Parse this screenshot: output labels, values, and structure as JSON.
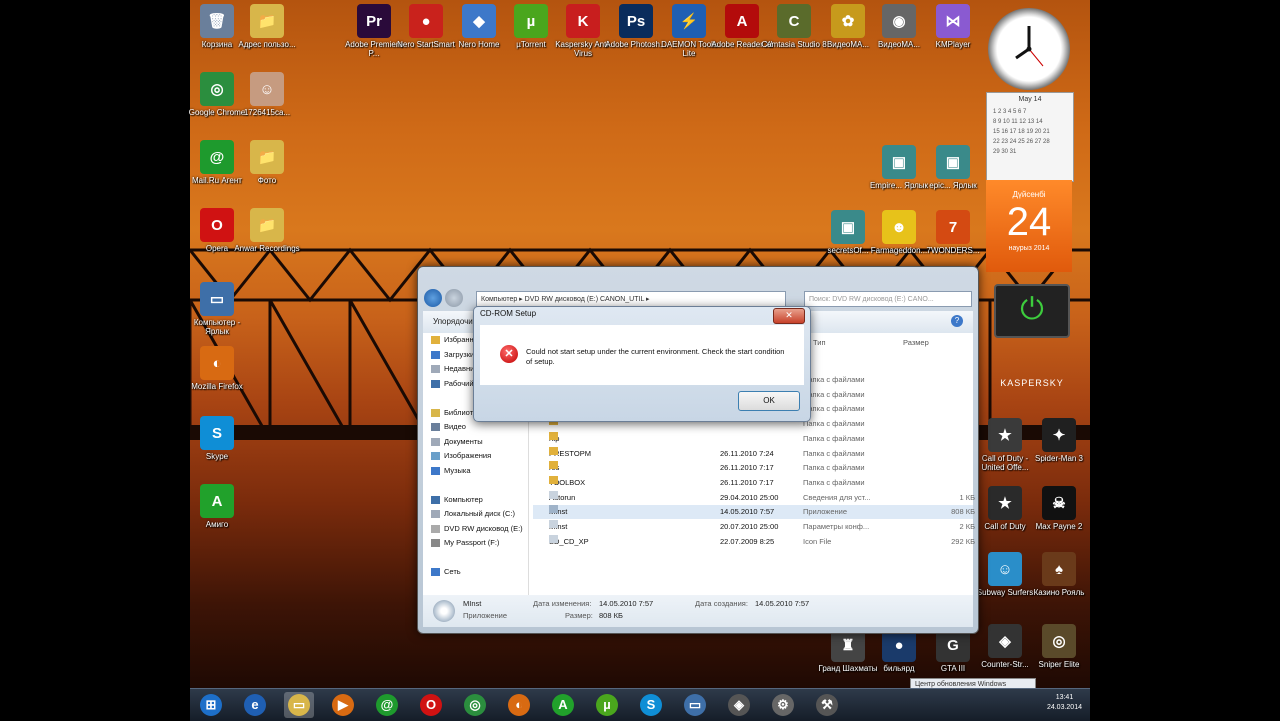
{
  "desktop_icons": [
    {
      "label": "Корзина",
      "color": "#6a7f9b",
      "glyph": "🗑"
    },
    {
      "label": "Адрес пользо...",
      "color": "#d8b64a",
      "glyph": "📁"
    },
    {
      "label": "Adobe Premiere P...",
      "color": "#2a0a3a",
      "glyph": "Pr"
    },
    {
      "label": "Nero StartSmart",
      "color": "#c9221c",
      "glyph": "●"
    },
    {
      "label": "Nero Home",
      "color": "#3d78c9",
      "glyph": "◆"
    },
    {
      "label": "µTorrent",
      "color": "#4aa61d",
      "glyph": "µ"
    },
    {
      "label": "Kaspersky Anti-Virus",
      "color": "#c81e1e",
      "glyph": "K"
    },
    {
      "label": "Adobe Photosh...",
      "color": "#0a2c5c",
      "glyph": "Ps"
    },
    {
      "label": "DAEMON Tools Lite",
      "color": "#1f5fb3",
      "glyph": "⚡"
    },
    {
      "label": "Adobe Reader XI",
      "color": "#b30b0b",
      "glyph": "A"
    },
    {
      "label": "Camtasia Studio 8",
      "color": "#5a6b2b",
      "glyph": "C"
    },
    {
      "label": "ВидеоМА...",
      "color": "#c79a1c",
      "glyph": "✿"
    },
    {
      "label": "ВидеоМА...",
      "color": "#666",
      "glyph": "◉"
    },
    {
      "label": "KMPlayer",
      "color": "#8a5ad1",
      "glyph": "⋈"
    },
    {
      "label": "Google Chrome",
      "color": "#2b8e3e",
      "glyph": "◎"
    },
    {
      "label": "1726415ca...",
      "color": "#c69b80",
      "glyph": "☺"
    },
    {
      "label": "Mail.Ru Агент",
      "color": "#1e9a2d",
      "glyph": "@"
    },
    {
      "label": "Фото",
      "color": "#d8b64a",
      "glyph": "📁"
    },
    {
      "label": "Opera",
      "color": "#d01212",
      "glyph": "O"
    },
    {
      "label": "Anwar Recordings",
      "color": "#d8b64a",
      "glyph": "📁"
    },
    {
      "label": "Компьютер - Ярлык",
      "color": "#3e6fa8",
      "glyph": "▭"
    },
    {
      "label": "Mozilla Firefox",
      "color": "#d86a12",
      "glyph": "◐"
    },
    {
      "label": "Skype",
      "color": "#0f8ed6",
      "glyph": "S"
    },
    {
      "label": "Амиго",
      "color": "#21a12b",
      "glyph": "A"
    },
    {
      "label": "Empire... Ярлык",
      "color": "#3a8a8a",
      "glyph": "▣"
    },
    {
      "label": "epic... Ярлык",
      "color": "#3a8a8a",
      "glyph": "▣"
    },
    {
      "label": "secretsOf...",
      "color": "#3a8a8a",
      "glyph": "▣"
    },
    {
      "label": "Farmageddon...",
      "color": "#e7c21a",
      "glyph": "☻"
    },
    {
      "label": "7WONDERS...",
      "color": "#d44a12",
      "glyph": "7"
    },
    {
      "label": "Call of Duty - United Offe...",
      "color": "#3a3a3a",
      "glyph": "★"
    },
    {
      "label": "Spider-Man 3",
      "color": "#202020",
      "glyph": "✦"
    },
    {
      "label": "Call of Duty",
      "color": "#2a2a2a",
      "glyph": "★"
    },
    {
      "label": "Max Payne 2",
      "color": "#111",
      "glyph": "☠"
    },
    {
      "label": "Subway Surfers",
      "color": "#2a8ec9",
      "glyph": "☺"
    },
    {
      "label": "Казино Рояль",
      "color": "#6a3a1a",
      "glyph": "♠"
    },
    {
      "label": "Гранд Шахматы",
      "color": "#444",
      "glyph": "♜"
    },
    {
      "label": "бильярд",
      "color": "#1a3a6a",
      "glyph": "●"
    },
    {
      "label": "GTA III",
      "color": "#333",
      "glyph": "G"
    },
    {
      "label": "Counter-Str...",
      "color": "#333",
      "glyph": "◈"
    },
    {
      "label": "Sniper Elite",
      "color": "#5a4a2a",
      "glyph": "◎"
    }
  ],
  "explorer": {
    "address": "Компьютер  ▸ DVD RW дисковод (E:) CANON_UTIL ▸",
    "search_placeholder": "Поиск: DVD RW дисковод (E:) CANO...",
    "toolbar_label": "Упорядочить ▾",
    "col_type": "Тип",
    "col_size": "Размер",
    "nav_items": [
      {
        "label": "Избранное",
        "color": "#e1b13c"
      },
      {
        "label": "Загрузки",
        "color": "#3d78c9"
      },
      {
        "label": "Недавние места",
        "color": "#9fa9b8"
      },
      {
        "label": "Рабочий стол",
        "color": "#3e6fa8"
      },
      {
        "label": "",
        "color": "transparent"
      },
      {
        "label": "Библиотеки",
        "color": "#d8b64a"
      },
      {
        "label": "Видео",
        "color": "#6a7f9b"
      },
      {
        "label": "Документы",
        "color": "#9fa9b8"
      },
      {
        "label": "Изображения",
        "color": "#6a9fc9"
      },
      {
        "label": "Музыка",
        "color": "#3d78c9"
      },
      {
        "label": "",
        "color": "transparent"
      },
      {
        "label": "Компьютер",
        "color": "#3e6fa8"
      },
      {
        "label": "Локальный диск (C:)",
        "color": "#9fa9b8"
      },
      {
        "label": "DVD RW дисковод (E:)",
        "color": "#aaa"
      },
      {
        "label": "My Passport (F:)",
        "color": "#888"
      },
      {
        "label": "",
        "color": "transparent"
      },
      {
        "label": "Сеть",
        "color": "#3d78c9"
      }
    ],
    "files": [
      {
        "name": "",
        "date": "",
        "type": "Папка с файлами",
        "size": "",
        "icon": "folder"
      },
      {
        "name": "",
        "date": "",
        "type": "Папка с файлами",
        "size": "",
        "icon": "folder"
      },
      {
        "name": "",
        "date": "",
        "type": "Папка с файлами",
        "size": "",
        "icon": "folder"
      },
      {
        "name": "",
        "date": "",
        "type": "Папка с файлами",
        "size": "",
        "icon": "folder"
      },
      {
        "name": "ntp",
        "date": "",
        "type": "Папка с файлами",
        "size": "",
        "icon": "folder"
      },
      {
        "name": "PRESTOPM",
        "date": "26.11.2010 7:24",
        "type": "Папка с файлами",
        "size": "",
        "icon": "folder"
      },
      {
        "name": "res",
        "date": "26.11.2010 7:17",
        "type": "Папка с файлами",
        "size": "",
        "icon": "folder"
      },
      {
        "name": "TOOLBOX",
        "date": "26.11.2010 7:17",
        "type": "Папка с файлами",
        "size": "",
        "icon": "folder"
      },
      {
        "name": "Autorun",
        "date": "29.04.2010 25:00",
        "type": "Сведения для уст...",
        "size": "1 КБ",
        "icon": "file"
      },
      {
        "name": "MInst",
        "date": "14.05.2010 7:57",
        "type": "Приложение",
        "size": "808 КБ",
        "icon": "app"
      },
      {
        "name": "MInst",
        "date": "20.07.2010 25:00",
        "type": "Параметры конф...",
        "size": "2 КБ",
        "icon": "file"
      },
      {
        "name": "SD_CD_XP",
        "date": "22.07.2009 8:25",
        "type": "Icon File",
        "size": "292 КБ",
        "icon": "file"
      }
    ],
    "status": {
      "name": "MInst",
      "kind": "Приложение",
      "modified_label": "Дата изменения:",
      "modified": "14.05.2010 7:57",
      "created_label": "Дата создания:",
      "created": "14.05.2010 7:57",
      "size_label": "Размер:",
      "size": "808 КБ"
    }
  },
  "dialog": {
    "title": "CD-ROM Setup",
    "close": "✕",
    "message": "Could not start setup under the current environment. Check the start condition of setup.",
    "ok": "OK"
  },
  "gadgets": {
    "calendar_month": "May 14",
    "day": "24",
    "day_name": "Дүйсенбі",
    "month_name": "наурыз 2014",
    "kaspersky": "KASPERSKY"
  },
  "tooltip": "Центр обновления Windows",
  "taskbar": {
    "time": "13:41",
    "date": "24.03.2014",
    "buttons": [
      {
        "name": "start",
        "color": "#1d6fc9",
        "glyph": "⊞"
      },
      {
        "name": "ie",
        "color": "#1f5fb3",
        "glyph": "e"
      },
      {
        "name": "explorer",
        "color": "#d8b64a",
        "glyph": "▭"
      },
      {
        "name": "media",
        "color": "#d86a12",
        "glyph": "▶"
      },
      {
        "name": "mailru",
        "color": "#1e9a2d",
        "glyph": "@"
      },
      {
        "name": "opera",
        "color": "#d01212",
        "glyph": "O"
      },
      {
        "name": "chrome",
        "color": "#2b8e3e",
        "glyph": "◎"
      },
      {
        "name": "firefox",
        "color": "#d86a12",
        "glyph": "◐"
      },
      {
        "name": "amigo",
        "color": "#21a12b",
        "glyph": "A"
      },
      {
        "name": "utorrent",
        "color": "#4aa61d",
        "glyph": "µ"
      },
      {
        "name": "skype",
        "color": "#0f8ed6",
        "glyph": "S"
      },
      {
        "name": "computer",
        "color": "#3e6fa8",
        "glyph": "▭"
      },
      {
        "name": "daemon",
        "color": "#555",
        "glyph": "◈"
      },
      {
        "name": "setup",
        "color": "#666",
        "glyph": "⚙"
      },
      {
        "name": "tool",
        "color": "#555",
        "glyph": "⚒"
      }
    ]
  }
}
